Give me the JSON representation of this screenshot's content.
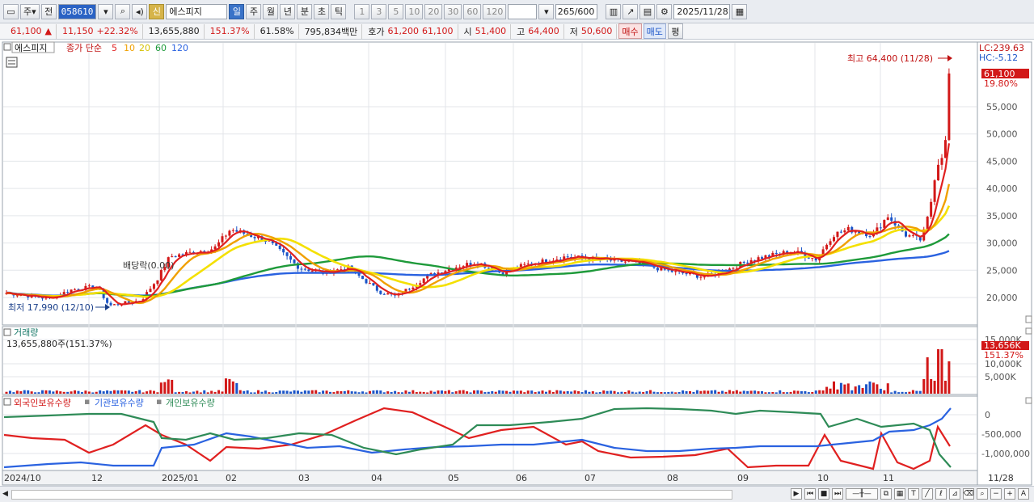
{
  "toolbar": {
    "period_type": "주",
    "prev_label": "전",
    "stock_code": "058610",
    "credit_badge": "신",
    "stock_name": "에스피지",
    "timeframes": [
      "일",
      "주",
      "월",
      "년",
      "분",
      "초",
      "틱"
    ],
    "selected_timeframe": "일",
    "intervals": [
      "1",
      "3",
      "5",
      "10",
      "20",
      "30",
      "60",
      "120"
    ],
    "count": "265/600",
    "date": "2025/11/28"
  },
  "quote": {
    "price": "61,100",
    "change": "11,150",
    "change_pct": "+22.32%",
    "volume": "13,655,880",
    "volume_ratio": "151.37%",
    "turnover": "61.58%",
    "amount": "795,834백만",
    "hoga_label": "호가",
    "ask": "61,200",
    "bid": "61,100",
    "open_label": "시",
    "open": "51,400",
    "high_label": "고",
    "high": "64,400",
    "low_label": "저",
    "low": "50,600",
    "buy_label": "매수",
    "sell_label": "매도",
    "eval_label": "평"
  },
  "price_panel": {
    "name": "에스피지",
    "ma_label": "종가 단순",
    "ma_periods": [
      "5",
      "10",
      "20",
      "60",
      "120"
    ],
    "lc": "LC:239.63",
    "hc": "HC:-5.12",
    "max_label": "최고 64,400 (11/28)",
    "min_label": "최저 17,990 (12/10)",
    "dividend_label": "배당락(0.00)",
    "current_price": "61,100",
    "current_pct": "19.80%",
    "y_ticks": [
      "55,000",
      "50,000",
      "45,000",
      "40,000",
      "35,000",
      "30,000",
      "25,000",
      "20,000"
    ]
  },
  "volume_panel": {
    "title": "거래량",
    "value": "13,655,880주(151.37%)",
    "current": "13,656K",
    "current_pct": "151.37%",
    "y_ticks": [
      "15,000K",
      "10,000K",
      "5,000K"
    ]
  },
  "holdings_panel": {
    "legend": [
      "외국인보유수량",
      "기관보유수량",
      "개인보유수량"
    ],
    "y_ticks": [
      "0",
      "-500,000",
      "-1,000,000"
    ]
  },
  "x_axis": {
    "labels": [
      "2024/10",
      "12",
      "2025/01",
      "02",
      "03",
      "04",
      "05",
      "06",
      "07",
      "08",
      "09",
      "10",
      "11"
    ],
    "last": "11/28"
  },
  "colors": {
    "up": "#d21818",
    "down": "#1a54c8",
    "ma5": "#e02020",
    "ma10": "#f0a000",
    "ma20": "#f4e000",
    "ma60": "#1e9a3a",
    "ma120": "#2a62e0",
    "foreign": "#e02020",
    "institution": "#2a62e0",
    "individual": "#2e8b57"
  },
  "chart_data": {
    "type": "line",
    "x": [
      "2024/10",
      "12",
      "2025/01",
      "02",
      "03",
      "04",
      "05",
      "06",
      "07",
      "08",
      "09",
      "10",
      "11",
      "11/28"
    ],
    "series": [
      {
        "name": "종가",
        "values": [
          21000,
          18500,
          21500,
          32000,
          25000,
          20000,
          25500,
          24500,
          27500,
          25000,
          24500,
          31000,
          32000,
          61100
        ]
      }
    ],
    "ylim": [
      17000,
      66000
    ]
  }
}
